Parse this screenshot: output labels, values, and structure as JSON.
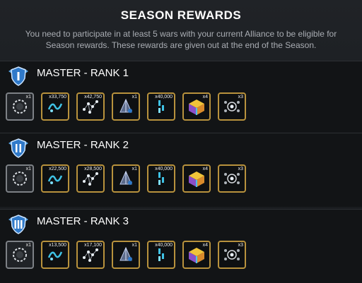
{
  "header": {
    "title": "SEASON REWARDS",
    "description": "You need to participate in at least 5 wars with your current Alliance to be eligible for Season rewards. These rewards are given out at the end of the Season."
  },
  "tiers": [
    {
      "name": "MASTER - RANK 1",
      "badge_icon": "rank-1-shield-icon",
      "items": [
        {
          "icon": "laurel-wreath-icon",
          "quantity": "x1"
        },
        {
          "icon": "catalyst-fragments-icon",
          "quantity": "x33,750"
        },
        {
          "icon": "constellation-shards-icon",
          "quantity": "x42,750"
        },
        {
          "icon": "crystal-shards-icon",
          "quantity": "x1"
        },
        {
          "icon": "gems-icon",
          "quantity": "x40,000"
        },
        {
          "icon": "golden-crystal-icon",
          "quantity": "x4"
        },
        {
          "icon": "signature-stone-icon",
          "quantity": "x3"
        }
      ]
    },
    {
      "name": "MASTER - RANK 2",
      "badge_icon": "rank-2-shield-icon",
      "items": [
        {
          "icon": "laurel-wreath-icon",
          "quantity": "x1"
        },
        {
          "icon": "catalyst-fragments-icon",
          "quantity": "x22,500"
        },
        {
          "icon": "constellation-shards-icon",
          "quantity": "x28,500"
        },
        {
          "icon": "crystal-shards-icon",
          "quantity": "x1"
        },
        {
          "icon": "gems-icon",
          "quantity": "x40,000"
        },
        {
          "icon": "golden-crystal-icon",
          "quantity": "x4"
        },
        {
          "icon": "signature-stone-icon",
          "quantity": "x3"
        }
      ]
    },
    {
      "name": "MASTER - RANK 3",
      "badge_icon": "rank-3-shield-icon",
      "items": [
        {
          "icon": "laurel-wreath-icon",
          "quantity": "x1"
        },
        {
          "icon": "catalyst-fragments-icon",
          "quantity": "x13,500"
        },
        {
          "icon": "constellation-shards-icon",
          "quantity": "x17,100"
        },
        {
          "icon": "crystal-shards-icon",
          "quantity": "x1"
        },
        {
          "icon": "gems-icon",
          "quantity": "x40,000"
        },
        {
          "icon": "golden-crystal-icon",
          "quantity": "x4"
        },
        {
          "icon": "signature-stone-icon",
          "quantity": "x3"
        }
      ]
    }
  ],
  "colors": {
    "background": "#1b1e22",
    "tier_background": "#121416",
    "gold_border": "#b8923d",
    "silver_border": "#7d8186",
    "badge_blue": "#2f79c9"
  }
}
